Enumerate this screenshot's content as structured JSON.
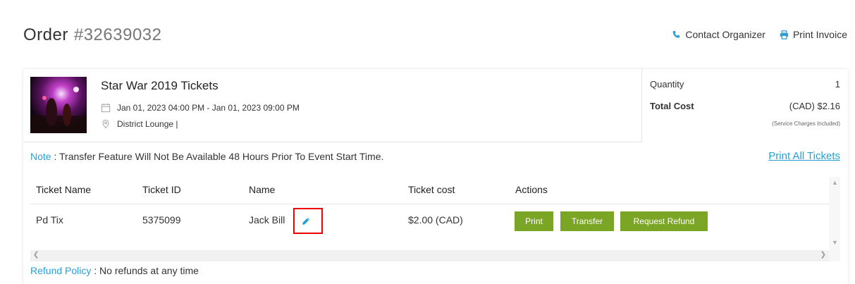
{
  "header": {
    "order_label": "Order",
    "order_number": "#32639032",
    "contact_label": "Contact Organizer",
    "print_invoice_label": "Print Invoice"
  },
  "event": {
    "title": "Star War 2019 Tickets",
    "datetime": "Jan 01, 2023 04:00 PM - Jan 01, 2023 09:00 PM",
    "venue": "District Lounge |"
  },
  "summary": {
    "quantity_label": "Quantity",
    "quantity_value": "1",
    "total_label": "Total Cost",
    "total_value": "(CAD) $2.16",
    "service_note": "(Service Charges Included)"
  },
  "note": {
    "label": "Note",
    "text": " : Transfer Feature Will Not Be Available 48 Hours Prior To Event Start Time."
  },
  "print_all_label": "Print All Tickets",
  "table": {
    "headers": [
      "Ticket Name",
      "Ticket ID",
      "Name",
      "Ticket cost",
      "Actions"
    ],
    "rows": [
      {
        "ticket_name": "Pd Tix",
        "ticket_id": "5375099",
        "name": "Jack Bill",
        "cost": "$2.00 (CAD)",
        "actions": [
          "Print",
          "Transfer",
          "Request Refund"
        ]
      }
    ]
  },
  "refund": {
    "label": "Refund Policy",
    "text": " : No refunds at any time"
  },
  "colors": {
    "accent_blue": "#2a9fd6",
    "button_green": "#7ba524",
    "highlight_red": "#e00000"
  },
  "icons": {
    "contact": "phone-icon",
    "invoice": "printer-icon",
    "date": "calendar-icon",
    "venue": "map-pin-icon",
    "edit": "pencil-icon"
  }
}
